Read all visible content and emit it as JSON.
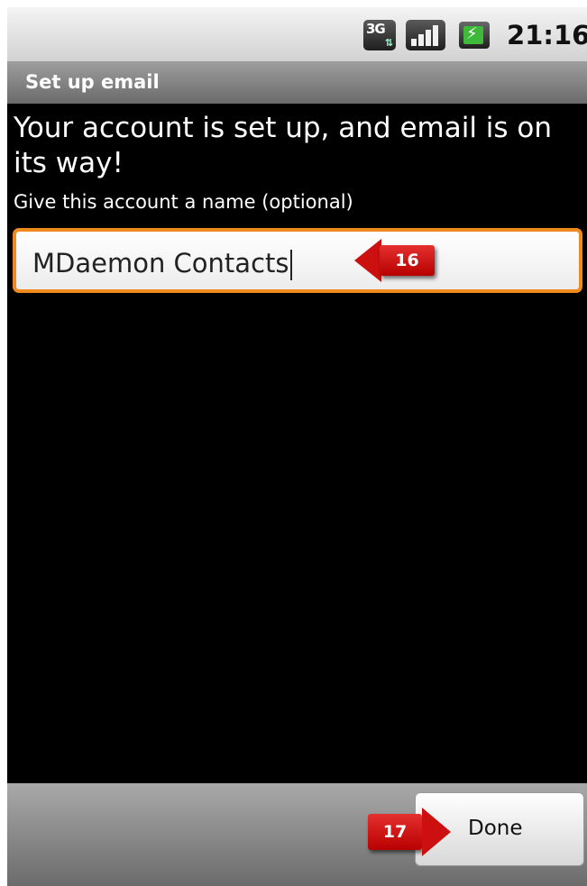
{
  "status_bar": {
    "network_label": "3G",
    "icons": [
      "3g-data-icon",
      "signal-strength-icon",
      "battery-charging-icon"
    ],
    "time": "21:16"
  },
  "title_bar": {
    "title": "Set up email"
  },
  "main": {
    "heading": "Your account is set up, and email is on its way!",
    "name_label": "Give this account a name (optional)",
    "name_value": "MDaemon Contacts"
  },
  "callouts": {
    "step_16": "16",
    "step_17": "17"
  },
  "bottom_bar": {
    "done_label": "Done"
  },
  "colors": {
    "focus_border": "#f08a1c",
    "callout_red": "#cc1010",
    "battery_green": "#3fb93a"
  }
}
